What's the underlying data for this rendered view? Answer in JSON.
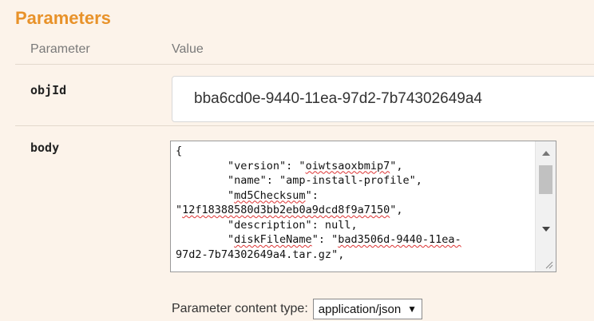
{
  "section": {
    "title": "Parameters"
  },
  "columns": {
    "parameter": "Parameter",
    "value": "Value"
  },
  "params": [
    {
      "name": "objId",
      "value": "bba6cd0e-9440-11ea-97d2-7b74302649a4"
    },
    {
      "name": "body",
      "lines": [
        [
          "{"
        ],
        [
          "        \"version\": \"",
          {
            "t": "oiwtsaoxbmip7",
            "err": true
          },
          "\","
        ],
        [
          "        \"name\": \"amp-install-profile\","
        ],
        [
          "        \"",
          {
            "t": "md5Checksum",
            "err": true
          },
          "\":"
        ],
        [
          "\"",
          {
            "t": "12f18388580d3bb2eb0a9dcd8f9a7150",
            "err": true
          },
          "\","
        ],
        [
          "        \"description\": null,"
        ],
        [
          "        \"",
          {
            "t": "diskFileName",
            "err": true
          },
          "\": \"",
          {
            "t": "bad3506d-9440-11ea-",
            "err": true
          }
        ],
        [
          "97d2-7b74302649a4.tar.gz\","
        ]
      ]
    }
  ],
  "content_type": {
    "label": "Parameter content type:",
    "selected": "application/json",
    "arrow": "▼"
  },
  "colors": {
    "title": "#e8922a",
    "background": "#fcf3ea",
    "spellcheck": "#dd3333"
  }
}
